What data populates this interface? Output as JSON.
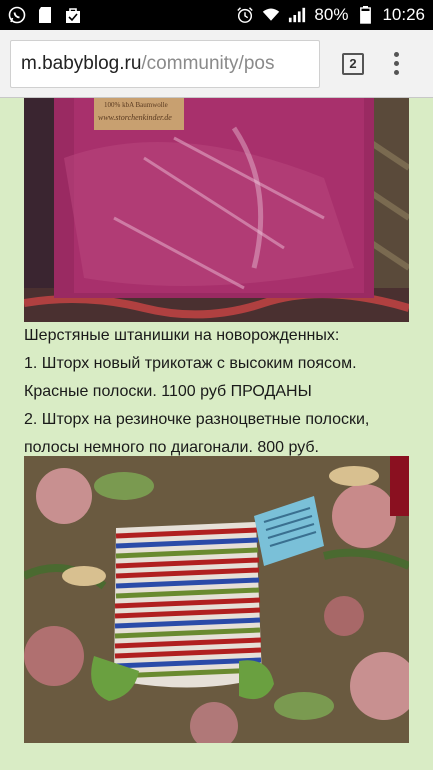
{
  "status_bar": {
    "battery": "80%",
    "time": "10:26"
  },
  "browser": {
    "url_host": "m.babyblog.ru",
    "url_path": "/community/pos",
    "tab_count": "2"
  },
  "photo1": {
    "label_line1": "100% kbA Baumwolle",
    "label_line2": "www.storchenkinder.de"
  },
  "post": {
    "lines": [
      "Шерстяные штанишки на новорожденных:",
      "1. Шторх новый трикотаж с высоким поясом.",
      "Красные полоски. 1100 руб ПРОДАНЫ",
      "2. Шторх на резиночке разноцветные полоски,",
      "полосы немного по диагонали. 800 руб."
    ]
  },
  "colors": {
    "page_background": "#d9ecc5",
    "status_bar": "#000000",
    "toolbar": "#f2f2f2"
  }
}
